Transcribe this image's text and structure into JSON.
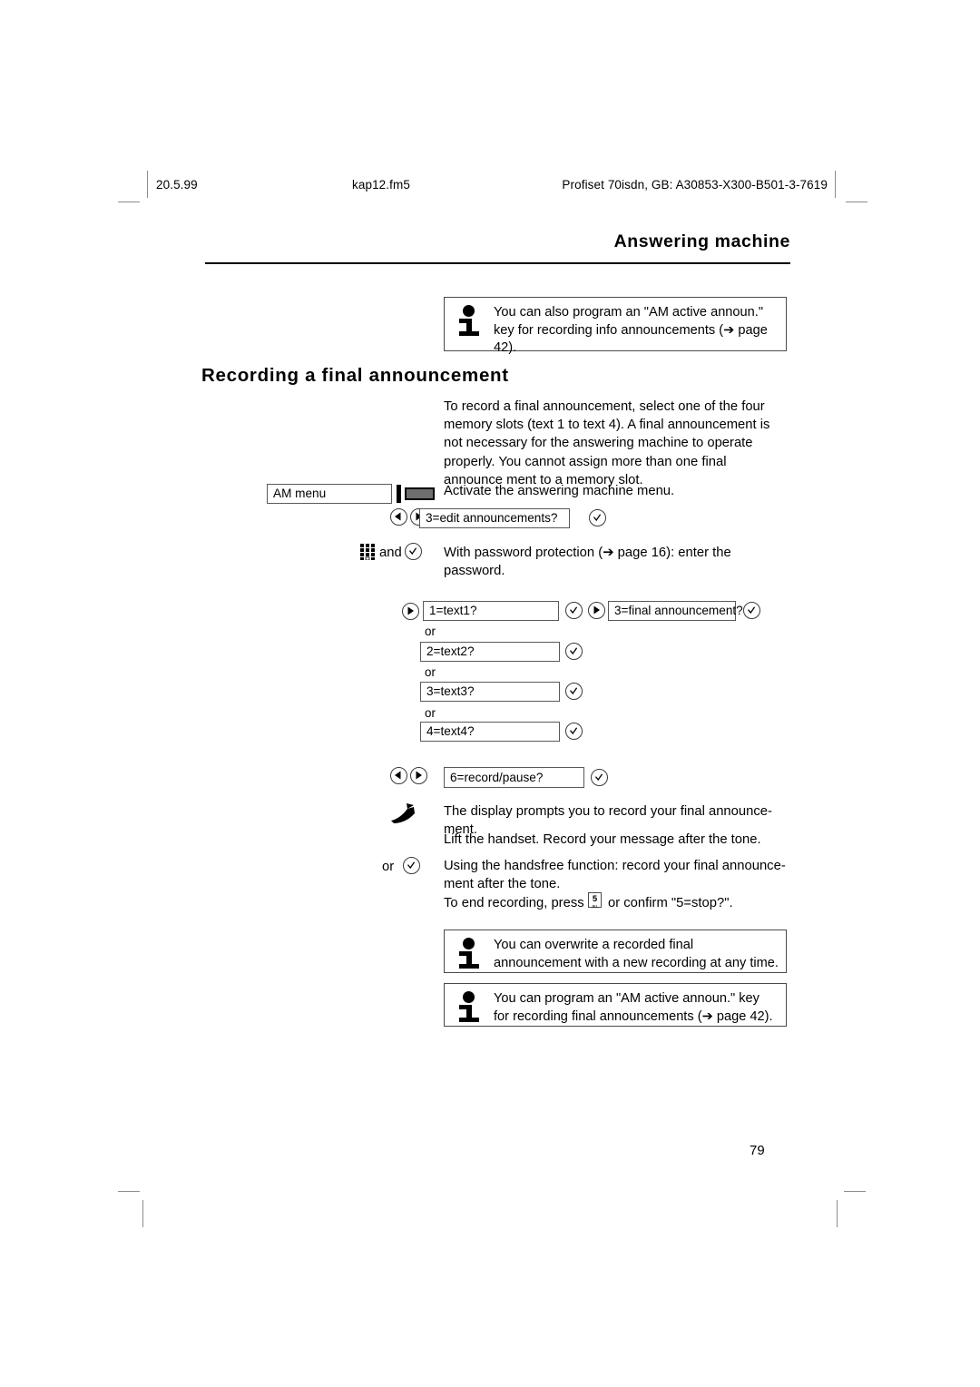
{
  "header": {
    "date": "20.5.99",
    "filename": "kap12.fm5",
    "document_id": "Profiset 70isdn, GB: A30853-X300-B501-3-7619"
  },
  "chapter_title": "Answering machine",
  "top_note": {
    "icon": "info-icon",
    "text": "You can also program an \"AM active announ.\" key for recording info announcements (➔ page 42)."
  },
  "section_heading": "Recording a final announcement",
  "intro_paragraph": "To record a final announcement, select one of the four memory slots (text 1 to text 4). A final announcement is not necessary for the answering machine to operate properly. You cannot assign more than one final announce­ ment to a memory slot.",
  "steps": {
    "am_menu_display": "AM menu",
    "am_menu_instruction": "Activate the answering machine menu.",
    "edit_announcements_display": "3=edit announcements?",
    "password_label": "and",
    "password_instruction": "With password protection (➔ page 16): enter the password.",
    "or_label": "or",
    "text_options": [
      {
        "display": "1=text1?"
      },
      {
        "display": "2=text2?"
      },
      {
        "display": "3=text3?"
      },
      {
        "display": "4=text4?"
      }
    ],
    "final_announcement_display": "3=final announcement?",
    "record_pause_display": "6=record/pause?",
    "handset_instruction_line1": "The display prompts you to record your final announce­ ment.",
    "handset_instruction_line2": "Lift the handset. Record your message after the tone.",
    "handsfree_or_label": "or",
    "handsfree_instruction": "Using the handsfree function: record your final announce­ ment after the tone.",
    "end_recording_prefix": "To end recording, press",
    "end_recording_key": "5",
    "end_recording_key_sub": "JKL",
    "end_recording_suffix": "or confirm \"5=stop?\"."
  },
  "bottom_notes": [
    {
      "icon": "info-icon",
      "text": "You can overwrite a recorded final announcement with a new recording at any time."
    },
    {
      "icon": "info-icon",
      "text": "You can program an \"AM active announ.\" key for recording final announcements (➔ page 42)."
    }
  ],
  "page_number": "79",
  "colors": {
    "text": "#000000",
    "box_border": "#4a4a4a",
    "crop_mark": "#8c8c8c",
    "led_fill": "#6e6e6e"
  }
}
